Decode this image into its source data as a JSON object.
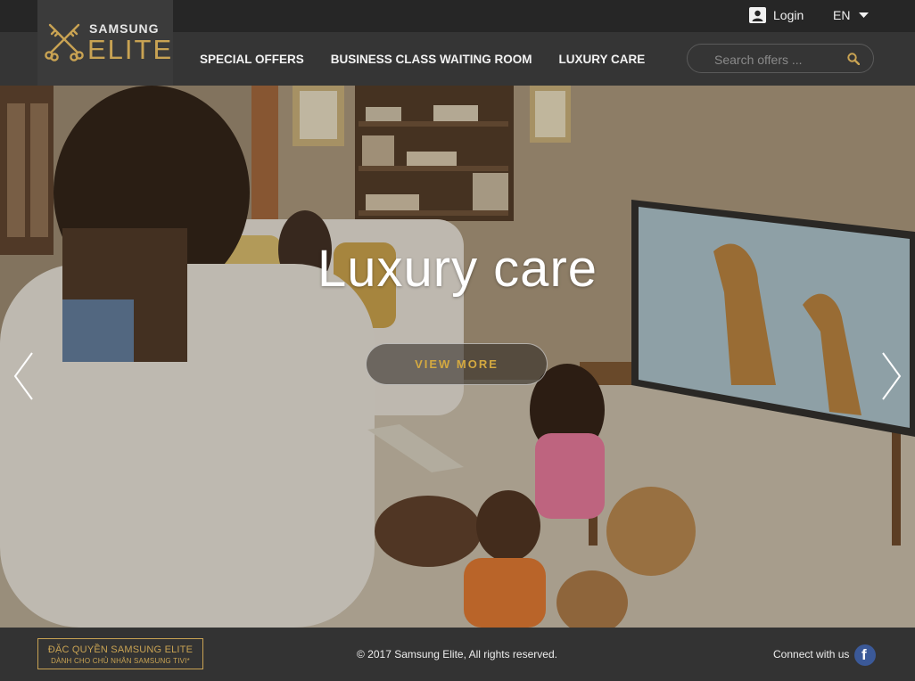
{
  "header": {
    "login_label": "Login",
    "language": "EN"
  },
  "logo": {
    "brand_top": "SAMSUNG",
    "brand_main": "ELITE"
  },
  "nav": {
    "items": [
      {
        "label": "SPECIAL OFFERS"
      },
      {
        "label": "BUSINESS CLASS WAITING ROOM"
      },
      {
        "label": "LUXURY CARE"
      }
    ]
  },
  "search": {
    "placeholder": "Search offers ...",
    "value": ""
  },
  "hero": {
    "title": "Luxury care",
    "cta_label": "VIEW MORE"
  },
  "footer": {
    "badge_line1": "ĐẶC QUYỀN SAMSUNG ELITE",
    "badge_line2": "DÀNH CHO CHỦ NHÂN SAMSUNG TIVI*",
    "copyright": "© 2017 Samsung Elite, All rights reserved.",
    "connect_label": "Connect with us"
  },
  "colors": {
    "accent_gold": "#c9a353",
    "cta_gold": "#d4a940",
    "bar_dark": "#262626",
    "nav_bg": "#353535",
    "facebook_blue": "#3b5998"
  },
  "icons": {
    "user": "user-icon",
    "caret": "caret-down-icon",
    "search": "search-icon",
    "prev": "chevron-left-icon",
    "next": "chevron-right-icon",
    "facebook": "facebook-icon",
    "logo": "crossed-keys-icon"
  }
}
